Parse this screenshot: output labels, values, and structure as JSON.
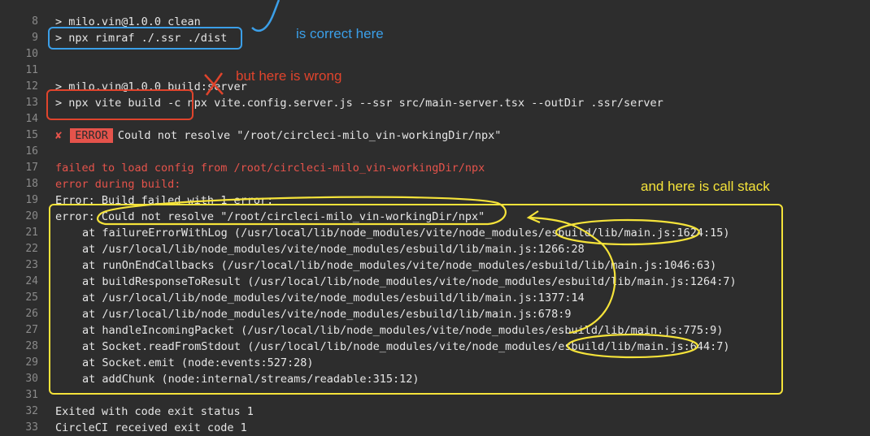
{
  "lines": [
    {
      "n": "8",
      "text": "> milo.vin@1.0.0 clean",
      "kind": "normal"
    },
    {
      "n": "9",
      "text": "> npx rimraf ./.ssr ./dist",
      "kind": "normal"
    },
    {
      "n": "10",
      "text": "",
      "kind": "normal"
    },
    {
      "n": "11",
      "text": "",
      "kind": "normal"
    },
    {
      "n": "12",
      "text": "> milo.vin@1.0.0 build:server",
      "kind": "normal"
    },
    {
      "n": "13",
      "text": "> npx vite build -c npx vite.config.server.js --ssr src/main-server.tsx --outDir .ssr/server",
      "kind": "normal"
    },
    {
      "n": "14",
      "text": "",
      "kind": "normal"
    },
    {
      "n": "15",
      "text": "",
      "kind": "error-line"
    },
    {
      "n": "16",
      "text": "",
      "kind": "normal"
    },
    {
      "n": "17",
      "text": "failed to load config from /root/circleci-milo_vin-workingDir/npx",
      "kind": "red"
    },
    {
      "n": "18",
      "text": "error during build:",
      "kind": "red"
    },
    {
      "n": "19",
      "text": "Error: Build failed with 1 error:",
      "kind": "normal"
    },
    {
      "n": "20",
      "text": "error: Could not resolve \"/root/circleci-milo_vin-workingDir/npx\"",
      "kind": "normal"
    },
    {
      "n": "21",
      "text": "at failureErrorWithLog (/usr/local/lib/node_modules/vite/node_modules/esbuild/lib/main.js:1624:15)",
      "kind": "indent"
    },
    {
      "n": "22",
      "text": "at /usr/local/lib/node_modules/vite/node_modules/esbuild/lib/main.js:1266:28",
      "kind": "indent"
    },
    {
      "n": "23",
      "text": "at runOnEndCallbacks (/usr/local/lib/node_modules/vite/node_modules/esbuild/lib/main.js:1046:63)",
      "kind": "indent"
    },
    {
      "n": "24",
      "text": "at buildResponseToResult (/usr/local/lib/node_modules/vite/node_modules/esbuild/lib/main.js:1264:7)",
      "kind": "indent"
    },
    {
      "n": "25",
      "text": "at /usr/local/lib/node_modules/vite/node_modules/esbuild/lib/main.js:1377:14",
      "kind": "indent"
    },
    {
      "n": "26",
      "text": "at /usr/local/lib/node_modules/vite/node_modules/esbuild/lib/main.js:678:9",
      "kind": "indent"
    },
    {
      "n": "27",
      "text": "at handleIncomingPacket (/usr/local/lib/node_modules/vite/node_modules/esbuild/lib/main.js:775:9)",
      "kind": "indent"
    },
    {
      "n": "28",
      "text": "at Socket.readFromStdout (/usr/local/lib/node_modules/vite/node_modules/esbuild/lib/main.js:644:7)",
      "kind": "indent"
    },
    {
      "n": "29",
      "text": "at Socket.emit (node:events:527:28)",
      "kind": "indent"
    },
    {
      "n": "30",
      "text": "at addChunk (node:internal/streams/readable:315:12)",
      "kind": "indent"
    },
    {
      "n": "31",
      "text": "",
      "kind": "normal"
    },
    {
      "n": "32",
      "text": "Exited with code exit status 1",
      "kind": "normal"
    },
    {
      "n": "33",
      "text": "CircleCI received exit code 1",
      "kind": "normal"
    }
  ],
  "error_line": {
    "mark": "✘",
    "badge": "ERROR",
    "message": "Could not resolve \"/root/circleci-milo_vin-workingDir/npx\""
  },
  "annotations": {
    "correct": "is correct here",
    "wrong": "but here is wrong",
    "stack": "and here is call stack"
  },
  "colors": {
    "background": "#2d2d2d",
    "text": "#e6e6e6",
    "line_number": "#8a8a8a",
    "error_red": "#e5534b",
    "blue_annotation": "#3b9fe8",
    "red_annotation": "#e0442c",
    "yellow_annotation": "#f5e33a"
  }
}
